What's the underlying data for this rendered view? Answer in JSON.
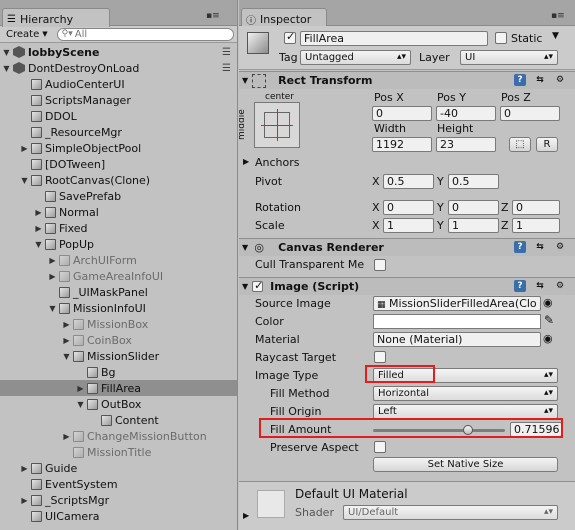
{
  "hierarchy": {
    "tab_label": "Hierarchy",
    "create_label": "Create",
    "search_placeholder": "All",
    "items": [
      {
        "label": "lobbyScene",
        "depth": 0,
        "kind": "scene",
        "expanded": true,
        "bold": true
      },
      {
        "label": "DontDestroyOnLoad",
        "depth": 0,
        "kind": "scene",
        "expanded": true
      },
      {
        "label": "AudioCenterUI",
        "depth": 1,
        "arrow": false
      },
      {
        "label": "ScriptsManager",
        "depth": 1,
        "arrow": false
      },
      {
        "label": "DDOL",
        "depth": 1,
        "arrow": false
      },
      {
        "label": "_ResourceMgr",
        "depth": 1,
        "arrow": false
      },
      {
        "label": "SimpleObjectPool",
        "depth": 1,
        "arrow": true,
        "expanded": false
      },
      {
        "label": "[DOTween]",
        "depth": 1,
        "arrow": false
      },
      {
        "label": "RootCanvas(Clone)",
        "depth": 1,
        "arrow": true,
        "expanded": true
      },
      {
        "label": "SavePrefab",
        "depth": 2,
        "arrow": false
      },
      {
        "label": "Normal",
        "depth": 2,
        "arrow": true,
        "expanded": false
      },
      {
        "label": "Fixed",
        "depth": 2,
        "arrow": true,
        "expanded": false
      },
      {
        "label": "PopUp",
        "depth": 2,
        "arrow": true,
        "expanded": true
      },
      {
        "label": "ArchUIForm",
        "depth": 3,
        "arrow": true,
        "expanded": false,
        "dim": true
      },
      {
        "label": "GameAreaInfoUI",
        "depth": 3,
        "arrow": true,
        "expanded": false,
        "dim": true
      },
      {
        "label": "_UIMaskPanel",
        "depth": 3,
        "arrow": false
      },
      {
        "label": "MissionInfoUI",
        "depth": 3,
        "arrow": true,
        "expanded": true
      },
      {
        "label": "MissionBox",
        "depth": 4,
        "arrow": true,
        "expanded": false,
        "dim": true
      },
      {
        "label": "CoinBox",
        "depth": 4,
        "arrow": true,
        "expanded": false,
        "dim": true
      },
      {
        "label": "MissionSlider",
        "depth": 4,
        "arrow": true,
        "expanded": true
      },
      {
        "label": "Bg",
        "depth": 5,
        "arrow": false
      },
      {
        "label": "FillArea",
        "depth": 5,
        "arrow": true,
        "expanded": false,
        "selected": true
      },
      {
        "label": "OutBox",
        "depth": 5,
        "arrow": true,
        "expanded": true
      },
      {
        "label": "Content",
        "depth": 6,
        "arrow": false
      },
      {
        "label": "ChangeMissionButton",
        "depth": 4,
        "arrow": true,
        "expanded": false,
        "dim": true
      },
      {
        "label": "MissionTitle",
        "depth": 4,
        "arrow": false,
        "dim": true
      },
      {
        "label": "Guide",
        "depth": 1,
        "arrow": true,
        "expanded": false
      },
      {
        "label": "EventSystem",
        "depth": 1,
        "arrow": false
      },
      {
        "label": "_ScriptsMgr",
        "depth": 1,
        "arrow": true,
        "expanded": false
      },
      {
        "label": "UICamera",
        "depth": 1,
        "arrow": false
      }
    ]
  },
  "inspector": {
    "tab_label": "Inspector",
    "object_name": "FillArea",
    "static_label": "Static",
    "tag_label": "Tag",
    "tag_value": "Untagged",
    "layer_label": "Layer",
    "layer_value": "UI",
    "rect_transform": {
      "title": "Rect Transform",
      "anchor_h": "center",
      "anchor_v": "middle",
      "pos_x_label": "Pos X",
      "pos_y_label": "Pos Y",
      "pos_z_label": "Pos Z",
      "pos_x": "0",
      "pos_y": "-40",
      "pos_z": "0",
      "width_label": "Width",
      "height_label": "Height",
      "width": "1192",
      "height": "23",
      "anchors_label": "Anchors",
      "pivot_label": "Pivot",
      "pivot_x": "0.5",
      "pivot_y": "0.5",
      "rotation_label": "Rotation",
      "rot_x": "0",
      "rot_y": "0",
      "rot_z": "0",
      "scale_label": "Scale",
      "scale_x": "1",
      "scale_y": "1",
      "scale_z": "1",
      "x": "X",
      "y": "Y",
      "z": "Z",
      "r_button": "R"
    },
    "canvas_renderer": {
      "title": "Canvas Renderer",
      "cull_label": "Cull Transparent Me"
    },
    "image": {
      "title": "Image (Script)",
      "source_label": "Source Image",
      "source_value": "MissionSliderFilledArea(Clo",
      "color_label": "Color",
      "material_label": "Material",
      "material_value": "None (Material)",
      "raycast_label": "Raycast Target",
      "image_type_label": "Image Type",
      "image_type_value": "Filled",
      "fill_method_label": "Fill Method",
      "fill_method_value": "Horizontal",
      "fill_origin_label": "Fill Origin",
      "fill_origin_value": "Left",
      "fill_amount_label": "Fill Amount",
      "fill_amount_value": "0.71596",
      "fill_amount": 0.71596,
      "preserve_label": "Preserve Aspect",
      "native_size_button": "Set Native Size"
    },
    "material_preview": {
      "name": "Default UI Material",
      "shader_label": "Shader",
      "shader_value": "UI/Default"
    }
  },
  "colors": {
    "highlight": "#e31d1d",
    "help_icon": "#3b6ea8",
    "selection": "#8f8f8f"
  }
}
